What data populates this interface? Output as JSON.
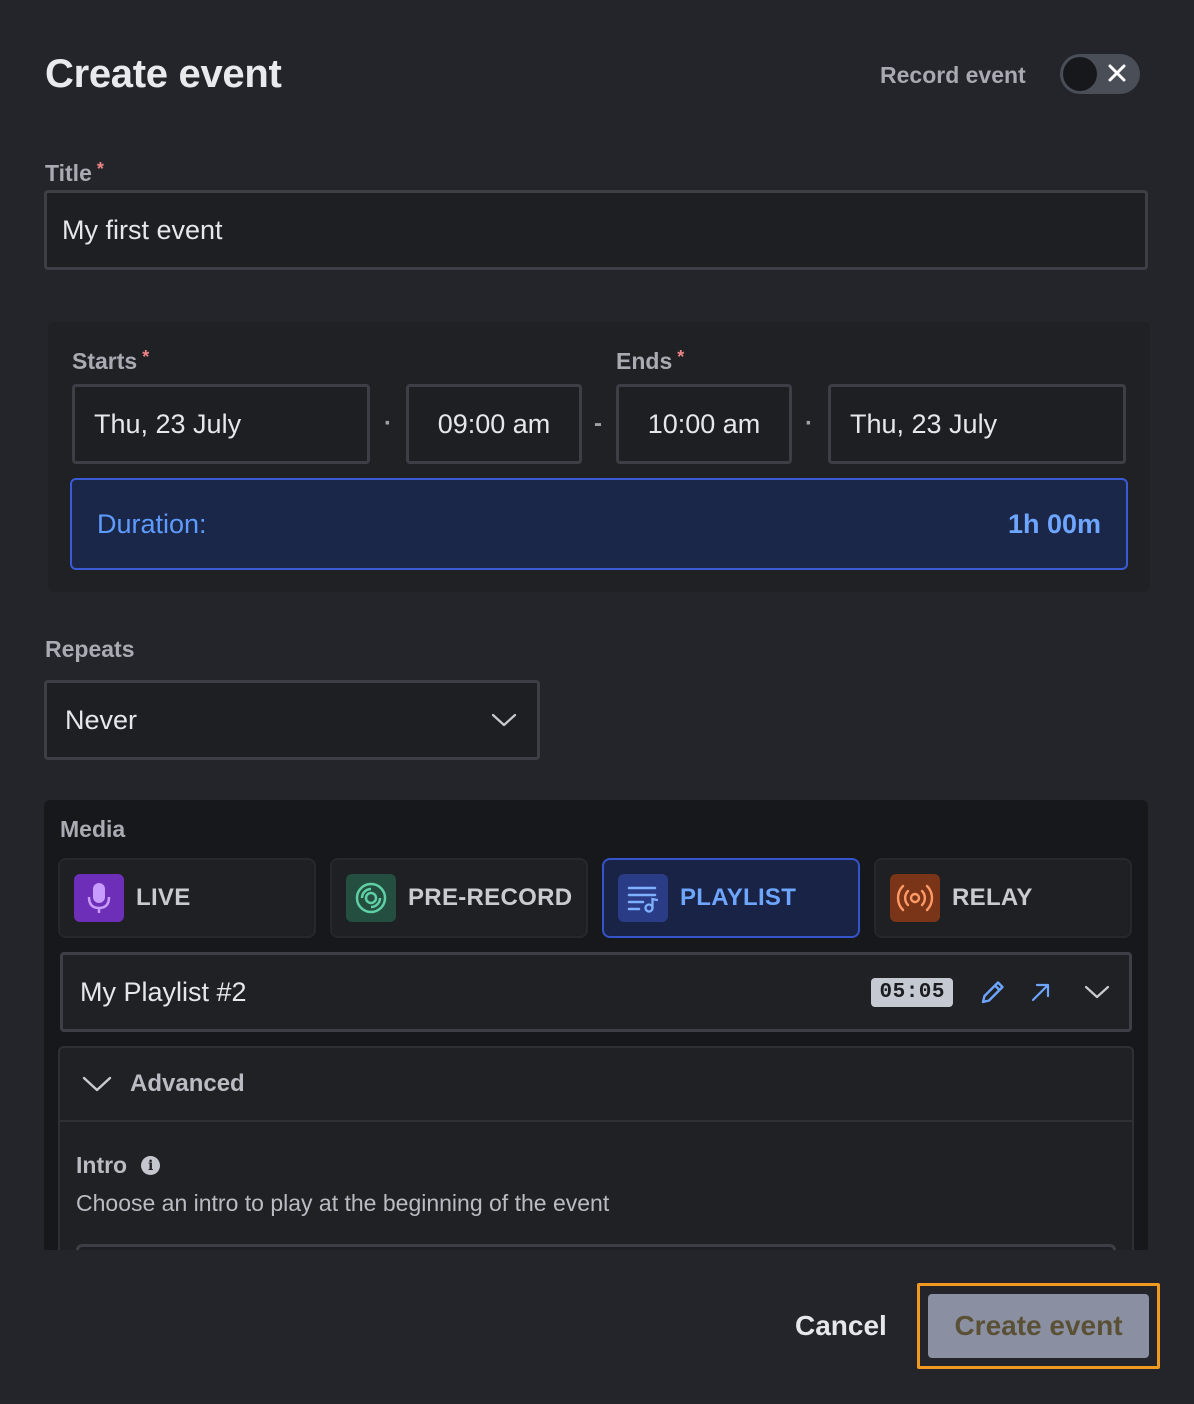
{
  "header": {
    "title": "Create event",
    "record_label": "Record event",
    "record_enabled": false
  },
  "title_field": {
    "label": "Title",
    "required_mark": "*",
    "value": "My first event"
  },
  "schedule": {
    "starts_label": "Starts",
    "ends_label": "Ends",
    "required_mark": "*",
    "start_date": "Thu, 23 July",
    "start_time": "09:00 am",
    "end_time": "10:00 am",
    "end_date": "Thu, 23 July",
    "dot_sep": "·",
    "dash_sep": "-",
    "duration_label": "Duration:",
    "duration_value": "1h 00m"
  },
  "repeats": {
    "label": "Repeats",
    "value": "Never"
  },
  "media": {
    "label": "Media",
    "tabs": [
      {
        "label": "LIVE",
        "icon": "microphone-icon",
        "color": "#8b3dd9"
      },
      {
        "label": "PRE-RECORD",
        "icon": "disc-icon",
        "color": "#2f6b55"
      },
      {
        "label": "PLAYLIST",
        "icon": "playlist-icon",
        "color": "#2c3f8f",
        "active": true
      },
      {
        "label": "RELAY",
        "icon": "broadcast-icon",
        "color": "#8a3b1f"
      }
    ],
    "playlist": {
      "name": "My Playlist #2",
      "duration": "05:05"
    },
    "advanced": {
      "label": "Advanced",
      "intro_label": "Intro",
      "intro_info": "i",
      "intro_description": "Choose an intro to play at the beginning of the event"
    }
  },
  "footer": {
    "cancel_label": "Cancel",
    "create_label": "Create event"
  }
}
